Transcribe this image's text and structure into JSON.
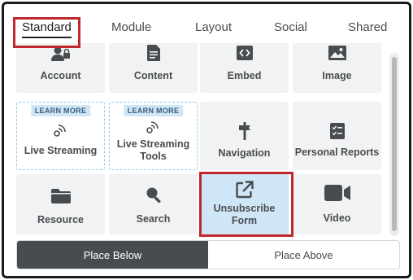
{
  "tabs": [
    {
      "label": "Standard",
      "active": true
    },
    {
      "label": "Module",
      "active": false
    },
    {
      "label": "Layout",
      "active": false
    },
    {
      "label": "Social",
      "active": false
    },
    {
      "label": "Shared",
      "active": false
    }
  ],
  "tiles": [
    {
      "label": "Account",
      "icon": "account-lock-icon"
    },
    {
      "label": "Content",
      "icon": "document-icon"
    },
    {
      "label": "Embed",
      "icon": "code-icon"
    },
    {
      "label": "Image",
      "icon": "image-icon"
    },
    {
      "label": "Live Streaming",
      "icon": "satellite-icon",
      "badge": "LEARN MORE"
    },
    {
      "label": "Live Streaming Tools",
      "icon": "satellite-icon",
      "badge": "LEARN MORE"
    },
    {
      "label": "Navigation",
      "icon": "signpost-icon"
    },
    {
      "label": "Personal Reports",
      "icon": "checklist-icon"
    },
    {
      "label": "Resource",
      "icon": "folder-icon"
    },
    {
      "label": "Search",
      "icon": "search-icon"
    },
    {
      "label": "Unsubscribe Form",
      "icon": "external-link-icon",
      "selected": true
    },
    {
      "label": "Video",
      "icon": "video-camera-icon"
    }
  ],
  "actions": {
    "place_below": "Place Below",
    "place_above": "Place Above"
  },
  "colors": {
    "tile_bg": "#f1f2f3",
    "selected_bg": "#cfe6f7",
    "highlight_red": "#c0282d",
    "primary_button": "#494c4e",
    "dashed_border": "#9bc6e4"
  }
}
